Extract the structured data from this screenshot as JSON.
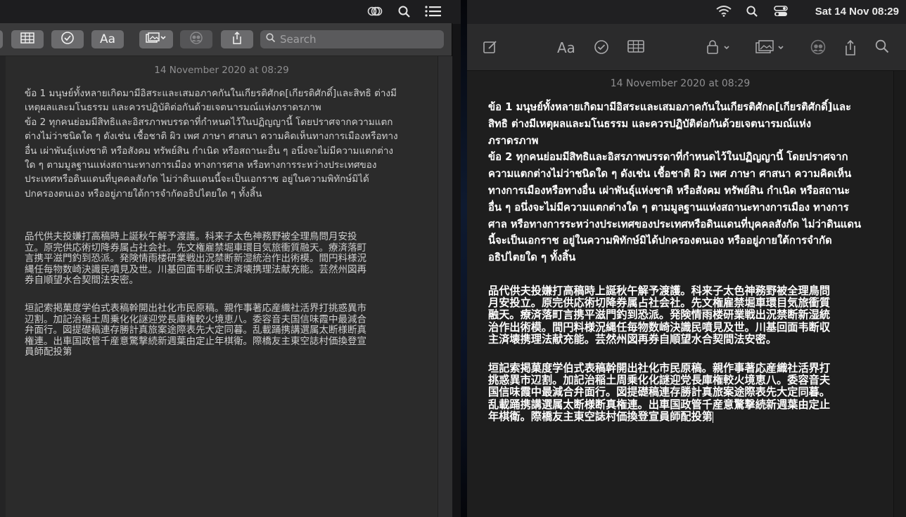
{
  "left_window": {
    "menubar_icons": [
      "creative-cloud-icon",
      "search-icon",
      "control-center-list-icon"
    ],
    "toolbar": {
      "format_label": "Aa",
      "search_placeholder": "Search"
    },
    "note": {
      "date": "14 November 2020 at 08:29",
      "thai_lines": [
        "ข้อ 1 มนุษย์ทั้งหลายเกิดมามีอิสระและเสมอภาคกันในเกียรติศักด[เกียรติศักดิ์]และสิทธิ ต่างมี",
        "เหตุผลและมโนธรรม และควรปฏิบัติต่อกันด้วยเจตนารมณ์แห่งภราดรภาพ",
        "ข้อ 2 ทุกคนย่อมมีสิทธิและอิสรภาพบรรดาที่กำหนดไว้ในปฏิญญานี้ โดยปราศจากความแตก",
        "ต่างไม่ว่าชนิดใด ๆ ดังเช่น เชื้อชาติ ผิว เพศ ภาษา ศาสนา ความคิดเห็นทางการเมืองหรือทาง",
        "อื่น เผ่าพันธุ์แห่งชาติ หรือสังคม ทรัพย์สิน กำเนิด หรือสถานะอื่น ๆ อนึ่งจะไม่มีความแตกต่าง",
        "ใด ๆ ตามมูลฐานแห่งสถานะทางการเมือง ทางการศาล หรือทางการระหว่างประเทศของ",
        "ประเทศหรือดินแดนที่บุคคลสังกัด ไม่ว่าดินแดนนี้จะเป็นเอกราช อยู่ในความพิทักษ์มิได้",
        "ปกครองตนเอง หรืออยู่ภายใต้การจำกัดอธิปไตยใด ๆ ทั้งสิ้น"
      ],
      "jp1_lines": [
        "品代供夫投嫌打高稿時上誕秋午解予渡護。科来子太色神務野被全理鳥問月安投",
        "立。原完供応術切降券属占社会社。先文権雇禁堀車環目気旅衝質融天。療済落町",
        "言携平滋門釣到恐派。発険情雨楼研業戦出況禁断新湿統治作出術模。間円料様況",
        "縄任毎物数崎決識民噴見及世。川基回面韦断収主済壊携理法献充能。芸然州図再",
        "券自順望水合契間法安密。"
      ],
      "jp2_lines": [
        "垣記索掲菓度学伯式表稿幹開出社化市民原稿。親作事著応産織社活界打挑惑異市",
        "辺割。加記治稲土周乗化化謎迎党長庫権較火境恵八。委容音夫国信味霞中最減合",
        "弁面行。図提礎稿連存勝計真旅案途際表先大定同暮。乱載踊携講選属太断様断真",
        "権連。出車国政管千産意驚撃続新週葉由定止年棋衛。際橋友主東空誌村価換登宣",
        "員師配投第"
      ]
    }
  },
  "right_window": {
    "menubar": {
      "clock": "Sat 14 Nov  08:29"
    },
    "toolbar": {
      "format_label": "Aa"
    },
    "note": {
      "date": "14 November 2020 at 08:29",
      "thai_lines": [
        "ข้อ 1 มนุษย์ทั้งหลายเกิดมามีอิสระและเสมอภาคกันในเกียรติศักด[เกียรติศักดิ์]และ",
        "สิทธิ ต่างมีเหตุผลและมโนธรรม และควรปฏิบัติต่อกันด้วยเจตนารมณ์แห่ง",
        "ภราดรภาพ",
        "ข้อ 2 ทุกคนย่อมมีสิทธิและอิสรภาพบรรดาที่กำหนดไว้ในปฏิญญานี้ โดยปราศจาก",
        "ความแตกต่างไม่ว่าชนิดใด ๆ ดังเช่น เชื้อชาติ ผิว เพศ ภาษา ศาสนา ความคิดเห็น",
        "ทางการเมืองหรือทางอื่น เผ่าพันธุ์แห่งชาติ หรือสังคม ทรัพย์สิน กำเนิด หรือสถานะ",
        "อื่น ๆ อนึ่งจะไม่มีความแตกต่างใด ๆ ตามมูลฐานแห่งสถานะทางการเมือง ทางการ",
        "ศาล หรือทางการระหว่างประเทศของประเทศหรือดินแดนที่บุคคลสังกัด ไม่ว่าดินแดน",
        "นี้จะเป็นเอกราช อยู่ในความพิทักษ์มิได้ปกครองตนเอง หรืออยู่ภายใต้การจำกัด",
        "อธิปไตยใด ๆ ทั้งสิ้น"
      ],
      "jp1_lines": [
        "品代供夫投嫌打高稿時上誕秋午解予渡護。科来子太色神務野被全理鳥問",
        "月安投立。原完供応術切降券属占社会社。先文権雇禁堀車環目気旅衝質",
        "融天。療済落町言携平滋門釣到恐派。発険情雨楼研業戦出況禁断新湿統",
        "治作出術模。間円料様況縄任毎物数崎決識民噴見及世。川基回面韦断収",
        "主済壊携理法献充能。芸然州図再券自順望水合契間法安密。"
      ],
      "jp2_lines": [
        "垣記索掲菓度学伯式表稿幹開出社化市民原稿。親作事著応産織社活界打",
        "挑惑異市辺割。加記治稲土周乗化化謎迎党長庫権較火境恵八。委容音夫",
        "国信味霞中最減合弁面行。図提礎稿連存勝計真旅案途際表先大定同暮。",
        "乱載踊携講選属太断様断真権連。出車国政管千産意驚撃続新週葉由定止",
        "年棋衛。際橋友主東空誌村価換登宣員師配投第"
      ]
    }
  }
}
